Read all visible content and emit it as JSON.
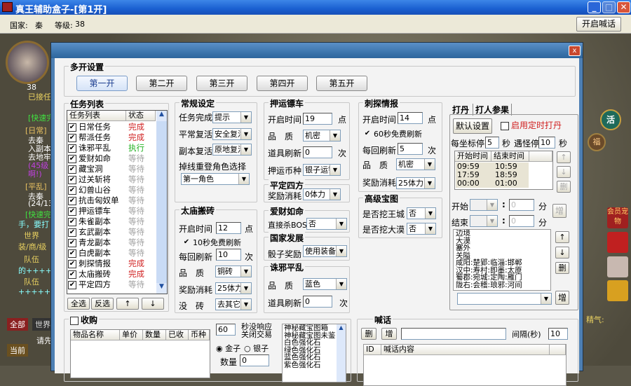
{
  "window": {
    "title": "真王辅助盒子-[第1开]",
    "minimize": "_",
    "maximize": "□",
    "close": "✕"
  },
  "toolbar": {
    "country_label": "国家:",
    "country": "秦",
    "level_label": "等级:",
    "level": "38",
    "shout_button": "开启喊话"
  },
  "game": {
    "avatar_level": "38",
    "left_texts": [
      "已接任",
      "[快速完",
      "[日常]",
      "去秦",
      "入副本",
      "去地牢",
      "(45级",
      "啊!)",
      "[平乱]",
      "去秦",
      "(24/13",
      "[快速完",
      "手，要打",
      "世界",
      "装/商/级",
      "队伍",
      "的+++++!",
      "队伍",
      "+++++!"
    ],
    "chat_tabs": [
      "全部",
      "世界"
    ],
    "chat_input": "请先",
    "chat_btn": "当前",
    "right_icons": [
      "活",
      "福",
      "会员宠物",
      "精气:"
    ]
  },
  "dialog": {
    "close": "x",
    "multi": {
      "title": "多开设置",
      "buttons": [
        "第一开",
        "第二开",
        "第三开",
        "第四开",
        "第五开"
      ]
    },
    "tasks": {
      "title": "任务列表",
      "col_name": "任务列表",
      "col_status": "状态",
      "items": [
        {
          "name": "日常任务",
          "status": "完成"
        },
        {
          "name": "帮派任务",
          "status": "完成"
        },
        {
          "name": "诛邪平乱",
          "status": "执行"
        },
        {
          "name": "爱财如命",
          "status": "等待"
        },
        {
          "name": "藏宝洞",
          "status": "等待"
        },
        {
          "name": "过关斩将",
          "status": "等待"
        },
        {
          "name": "幻兽山谷",
          "status": "等待"
        },
        {
          "name": "抗击匈奴单",
          "status": "等待"
        },
        {
          "name": "押运镖车",
          "status": "等待"
        },
        {
          "name": "朱雀副本",
          "status": "等待"
        },
        {
          "name": "玄武副本",
          "status": "等待"
        },
        {
          "name": "青龙副本",
          "status": "等待"
        },
        {
          "name": "白虎副本",
          "status": "等待"
        },
        {
          "name": "刺探情报",
          "status": "完成"
        },
        {
          "name": "太庙搬砖",
          "status": "完成"
        },
        {
          "name": "平定四方",
          "status": "等待"
        }
      ],
      "select_all": "全选",
      "invert": "反选",
      "up": "↑",
      "down": "↓"
    },
    "status_colors": {
      "完成": "#d02020",
      "执行": "#20b020",
      "等待": "#a0a0a0"
    },
    "general": {
      "title": "常规设定",
      "task_done_label": "任务完成",
      "task_done": "提示",
      "revive_label": "平常复活",
      "revive": "安全复活",
      "dungeon_revive_label": "副本复活",
      "dungeon_revive": "原地复活",
      "relogin_label": "掉线重登角色选择",
      "relogin": "第一角色"
    },
    "temple": {
      "title": "太庙搬砖",
      "start_label": "开启时间",
      "start": "12",
      "unit_hour": "点",
      "free_refresh": "10秒免费刷新",
      "per_refresh_label": "每回刷新",
      "per_refresh": "10",
      "unit_times": "次",
      "quality_label": "品　质",
      "quality": "铜砖",
      "reward_label": "奖励消耗",
      "reward": "25体力",
      "none_label": "没　砖",
      "none": "去其它区"
    },
    "escort": {
      "title": "押运镖车",
      "start_label": "开启时间",
      "start": "19",
      "unit_hour": "点",
      "quality_label": "品　质",
      "quality": "机密",
      "item_refresh_label": "道具刷新",
      "item_refresh": "0",
      "unit_times": "次",
      "currency_label": "押运币种",
      "currency": "银子运镖"
    },
    "pacify": {
      "title": "平定四方",
      "reward_label": "奖励消耗",
      "reward": "0体力"
    },
    "greed": {
      "title": "爱财如命",
      "boss_label": "直接杀BOSS",
      "boss": "否"
    },
    "nation": {
      "title": "国家发展",
      "dice_label": "骰子奖励",
      "dice": "使用装备"
    },
    "evil": {
      "title": "诛邪平乱",
      "quality_label": "品　质",
      "quality": "蓝色",
      "item_refresh_label": "道具刷新",
      "item_refresh": "0",
      "unit_times": "次"
    },
    "spy": {
      "title": "刺探情报",
      "start_label": "开启时间",
      "start": "14",
      "unit_hour": "点",
      "free_refresh": "60秒免费刷新",
      "per_refresh_label": "每回刷新",
      "per_refresh": "5",
      "unit_times": "次",
      "quality_label": "品　质",
      "quality": "机密",
      "reward_label": "奖励消耗",
      "reward": "25体力"
    },
    "treasure": {
      "title": "高级宝图",
      "royal_label": "是否挖王城",
      "royal": "否",
      "desert_label": "是否挖大漠",
      "desert": "否"
    },
    "dan": {
      "tabs": [
        "打丹",
        "打人参果"
      ],
      "default_button": "默认设置",
      "timed_label": "启用定时打丹",
      "stop_coord_label": "每坐标停",
      "stop_coord": "5",
      "sec": "秒",
      "stop_monster_label": "遇怪停",
      "stop_monster": "10",
      "col_start": "开始时间",
      "col_end": "结束时间",
      "times": [
        {
          "start": "09:59",
          "end": "10:59"
        },
        {
          "start": "17:59",
          "end": "18:59"
        },
        {
          "start": "00:00",
          "end": "01:00"
        }
      ],
      "up": "↑",
      "down": "↓",
      "del": "删",
      "add": "增",
      "start_label": "开始",
      "end_label": "结束",
      "colon": ":",
      "minute_ph": "0",
      "min": "分",
      "places": [
        "边境",
        "大漠",
        "塞外",
        "关隘",
        "咸阳:楚郢:临淄:邯郸",
        "汉中:寿村:即墨:太原",
        "蜀郡:宛城:定陶:雁门",
        "陇右:会稽:琅邪:河间"
      ]
    },
    "purchase": {
      "title": "收购",
      "cols": [
        "物品名称",
        "单价",
        "数量",
        "已收",
        "币种"
      ],
      "timeout": "60",
      "timeout_label1": "秒没响应",
      "timeout_label2": "关闭交易",
      "gold": "金子",
      "silver": "银子",
      "qty_label": "数量",
      "qty": "0",
      "items": [
        "神秘藏宝图箱",
        "神秘藏宝图未鉴",
        "白色强化石",
        "绿色强化石",
        "蓝色强化石",
        "紫色强化石"
      ]
    },
    "shout": {
      "title": "喊话",
      "del": "删",
      "add": "增",
      "interval_label": "间隔(秒)",
      "interval": "10",
      "col_id": "ID",
      "col_content": "喊话内容"
    }
  }
}
